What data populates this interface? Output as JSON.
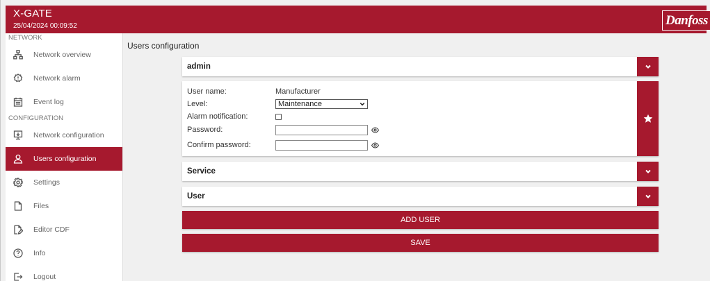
{
  "header": {
    "app_title": "X-GATE",
    "datetime": "25/04/2024 00:09:52",
    "logo_text": "Danfoss",
    "brand_color": "#a6192e"
  },
  "sidebar": {
    "network_section": "NETWORK",
    "configuration_section": "CONFIGURATION",
    "items": [
      {
        "label": "Network overview",
        "icon": "network-icon"
      },
      {
        "label": "Network alarm",
        "icon": "alarm-icon"
      },
      {
        "label": "Event log",
        "icon": "event-log-icon"
      },
      {
        "label": "Network configuration",
        "icon": "network-config-icon"
      },
      {
        "label": "Users configuration",
        "icon": "user-icon",
        "active": true
      },
      {
        "label": "Settings",
        "icon": "gear-icon"
      },
      {
        "label": "Files",
        "icon": "file-icon"
      },
      {
        "label": "Editor CDF",
        "icon": "editor-icon"
      },
      {
        "label": "Info",
        "icon": "info-icon"
      },
      {
        "label": "Logout",
        "icon": "logout-icon"
      }
    ]
  },
  "main": {
    "page_title": "Users configuration",
    "users": [
      {
        "name": "admin"
      },
      {
        "name": "Service"
      },
      {
        "name": "User"
      }
    ],
    "form": {
      "user_name_label": "User name:",
      "user_name_value": "Manufacturer",
      "level_label": "Level:",
      "level_value": "Maintenance",
      "alarm_label": "Alarm notification:",
      "alarm_checked": false,
      "password_label": "Password:",
      "password_value": "",
      "confirm_label": "Confirm password:",
      "confirm_value": ""
    },
    "add_user_label": "ADD USER",
    "save_label": "SAVE"
  }
}
